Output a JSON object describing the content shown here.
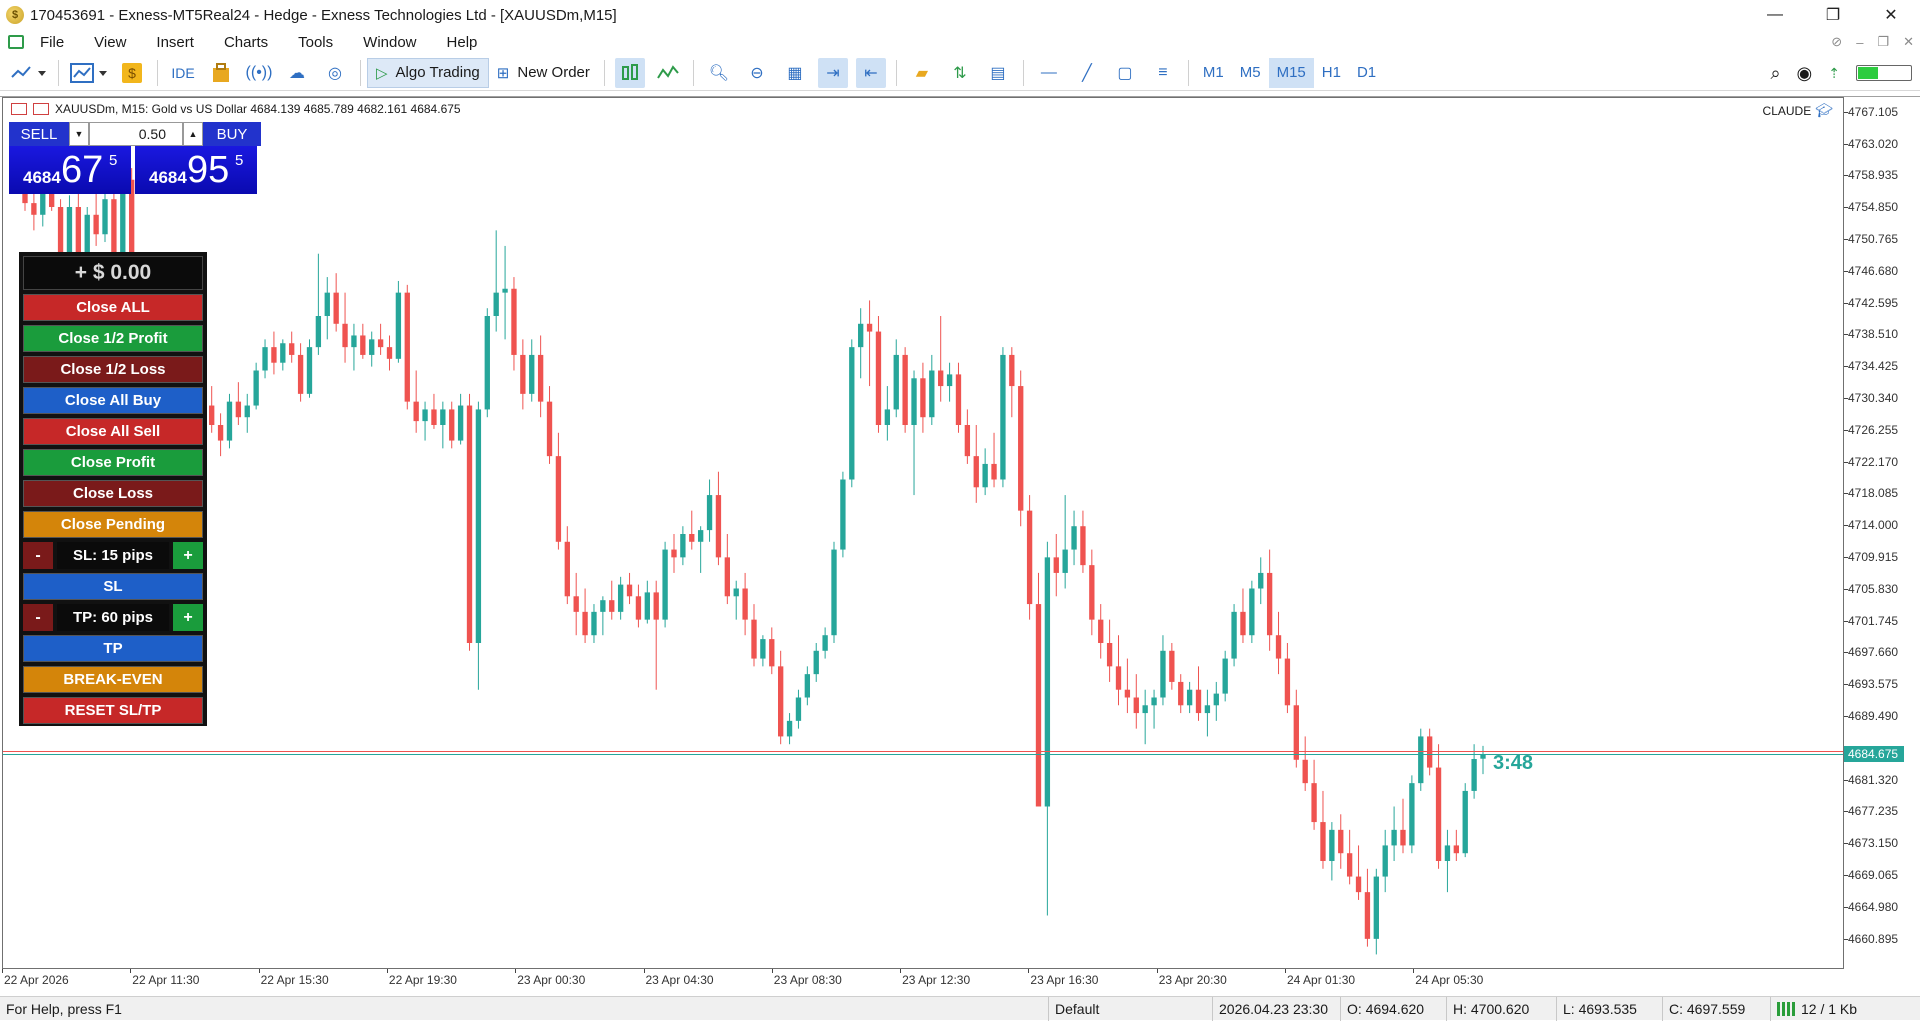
{
  "window": {
    "title": "170453691 - Exness-MT5Real24 - Hedge - Exness Technologies Ltd - [XAUUSDm,M15]",
    "controls": {
      "minimize": "—",
      "restore": "❐",
      "close": "✕"
    }
  },
  "menu": {
    "items": [
      "File",
      "View",
      "Insert",
      "Charts",
      "Tools",
      "Window",
      "Help"
    ]
  },
  "toolbar": {
    "ide_label": "IDE",
    "algo_label": "Algo Trading",
    "new_order_label": "New Order",
    "timeframes": [
      "M1",
      "M5",
      "M15",
      "H1",
      "D1"
    ],
    "active_timeframe": "M15"
  },
  "chart": {
    "info": "XAUUSDm, M15:  Gold vs US Dollar  4684.139 4685.789 4682.161 4684.675",
    "indicator_tag": "CLAUDE",
    "current_price_label": "4684.675",
    "countdown": "3:48",
    "up_color": "#26a69a",
    "down_color": "#ef5350",
    "price_labels": [
      "4767.105",
      "4763.020",
      "4758.935",
      "4754.850",
      "4750.765",
      "4746.680",
      "4742.595",
      "4738.510",
      "4734.425",
      "4730.340",
      "4726.255",
      "4722.170",
      "4718.085",
      "4714.000",
      "4709.915",
      "4705.830",
      "4701.745",
      "4697.660",
      "4693.575",
      "4689.490",
      "4681.320",
      "4677.235",
      "4673.150",
      "4669.065",
      "4664.980",
      "4660.895"
    ],
    "time_labels": [
      "22 Apr 2026",
      "22 Apr 11:30",
      "22 Apr 15:30",
      "22 Apr 19:30",
      "23 Apr 00:30",
      "23 Apr 04:30",
      "23 Apr 08:30",
      "23 Apr 12:30",
      "23 Apr 16:30",
      "23 Apr 20:30",
      "24 Apr 01:30",
      "24 Apr 05:30"
    ]
  },
  "one_click": {
    "sell_label": "SELL",
    "buy_label": "BUY",
    "lot": "0.50",
    "sell_small": "4684",
    "sell_big": "67",
    "sell_sup": "5",
    "buy_small": "4684",
    "buy_big": "95",
    "buy_sup": "5"
  },
  "panel": {
    "profit": "+ $ 0.00",
    "close_all": "Close ALL",
    "close_half_profit": "Close 1/2 Profit",
    "close_half_loss": "Close 1/2 Loss",
    "close_all_buy": "Close All Buy",
    "close_all_sell": "Close All Sell",
    "close_profit": "Close Profit",
    "close_loss": "Close Loss",
    "close_pending": "Close Pending",
    "minus": "-",
    "plus": "+",
    "sl_pips": "SL: 15 pips",
    "sl": "SL",
    "tp_pips": "TP: 60 pips",
    "tp": "TP",
    "break_even": "BREAK-EVEN",
    "reset": "RESET SL/TP"
  },
  "status": {
    "help": "For Help, press F1",
    "profile": "Default",
    "datetime": "2026.04.23 23:30",
    "open": "O: 4694.620",
    "high": "H: 4700.620",
    "low": "L: 4693.535",
    "close": "C: 4697.559",
    "traffic": "12 / 1 Kb"
  },
  "chart_data": {
    "type": "candlestick",
    "symbol": "XAUUSDm",
    "timeframe": "M15",
    "ylim": [
      4657.0,
      4769.0
    ],
    "candles": [
      [
        4757.0,
        4759.0,
        4754.5,
        4755.5
      ],
      [
        4755.5,
        4757.5,
        4752.0,
        4754.0
      ],
      [
        4754.0,
        4758.0,
        4752.5,
        4757.0
      ],
      [
        4757.0,
        4759.0,
        4754.5,
        4755.0
      ],
      [
        4755.0,
        4756.0,
        4747.0,
        4748.5
      ],
      [
        4748.5,
        4756.5,
        4748.0,
        4755.0
      ],
      [
        4755.0,
        4757.5,
        4746.0,
        4747.0
      ],
      [
        4747.0,
        4755.0,
        4746.5,
        4754.0
      ],
      [
        4754.0,
        4757.0,
        4750.0,
        4751.5
      ],
      [
        4751.5,
        4758.0,
        4750.5,
        4756.0
      ],
      [
        4756.0,
        4757.5,
        4748.0,
        4749.0
      ],
      [
        4749.0,
        4760.0,
        4748.5,
        4758.5
      ],
      [
        4758.5,
        4760.0,
        4745.0,
        4746.0
      ],
      [
        4746.0,
        4749.0,
        4742.0,
        4744.0
      ],
      [
        4744.0,
        4745.5,
        4734.0,
        4735.0
      ],
      [
        4735.0,
        4738.0,
        4733.0,
        4736.5
      ],
      [
        4736.5,
        4740.0,
        4735.5,
        4739.0
      ],
      [
        4739.0,
        4740.5,
        4733.5,
        4734.5
      ],
      [
        4734.5,
        4736.0,
        4728.0,
        4729.0
      ],
      [
        4729.0,
        4731.0,
        4725.5,
        4727.0
      ],
      [
        4727.0,
        4730.5,
        4726.0,
        4729.5
      ],
      [
        4729.5,
        4732.0,
        4726.0,
        4727.0
      ],
      [
        4727.0,
        4728.5,
        4723.0,
        4725.0
      ],
      [
        4725.0,
        4731.0,
        4724.0,
        4730.0
      ],
      [
        4730.0,
        4732.5,
        4727.0,
        4728.0
      ],
      [
        4728.0,
        4731.0,
        4726.0,
        4729.5
      ],
      [
        4729.5,
        4735.0,
        4729.0,
        4734.0
      ],
      [
        4734.0,
        4738.0,
        4733.0,
        4737.0
      ],
      [
        4737.0,
        4739.0,
        4733.5,
        4735.0
      ],
      [
        4735.0,
        4738.0,
        4734.0,
        4737.5
      ],
      [
        4737.5,
        4739.0,
        4735.0,
        4736.0
      ],
      [
        4736.0,
        4737.5,
        4730.0,
        4731.0
      ],
      [
        4731.0,
        4738.0,
        4730.5,
        4737.0
      ],
      [
        4737.0,
        4749.0,
        4736.0,
        4741.0
      ],
      [
        4741.0,
        4746.0,
        4738.0,
        4744.0
      ],
      [
        4744.0,
        4746.5,
        4739.0,
        4740.0
      ],
      [
        4740.0,
        4744.0,
        4735.0,
        4737.0
      ],
      [
        4737.0,
        4740.0,
        4734.0,
        4738.5
      ],
      [
        4738.5,
        4740.0,
        4735.5,
        4736.0
      ],
      [
        4736.0,
        4739.0,
        4734.5,
        4738.0
      ],
      [
        4738.0,
        4740.0,
        4736.0,
        4737.0
      ],
      [
        4737.0,
        4738.5,
        4734.0,
        4735.5
      ],
      [
        4735.5,
        4745.5,
        4735.0,
        4744.0
      ],
      [
        4744.0,
        4745.0,
        4729.0,
        4730.0
      ],
      [
        4730.0,
        4734.0,
        4726.0,
        4727.5
      ],
      [
        4727.5,
        4730.0,
        4725.0,
        4729.0
      ],
      [
        4729.0,
        4731.0,
        4726.5,
        4727.0
      ],
      [
        4727.0,
        4730.0,
        4724.0,
        4729.0
      ],
      [
        4729.0,
        4730.0,
        4724.0,
        4725.0
      ],
      [
        4725.0,
        4731.0,
        4724.5,
        4729.5
      ],
      [
        4729.5,
        4731.0,
        4698.0,
        4699.0
      ],
      [
        4699.0,
        4730.0,
        4693.0,
        4729.0
      ],
      [
        4729.0,
        4742.0,
        4728.0,
        4741.0
      ],
      [
        4741.0,
        4752.0,
        4739.0,
        4744.0
      ],
      [
        4744.0,
        4750.0,
        4738.0,
        4744.5
      ],
      [
        4744.5,
        4746.0,
        4734.0,
        4736.0
      ],
      [
        4736.0,
        4738.0,
        4729.0,
        4731.0
      ],
      [
        4731.0,
        4738.0,
        4730.0,
        4736.0
      ],
      [
        4736.0,
        4738.5,
        4728.0,
        4730.0
      ],
      [
        4730.0,
        4732.0,
        4722.0,
        4723.0
      ],
      [
        4723.0,
        4726.0,
        4711.0,
        4712.0
      ],
      [
        4712.0,
        4714.0,
        4704.0,
        4705.0
      ],
      [
        4705.0,
        4708.0,
        4700.0,
        4703.0
      ],
      [
        4703.0,
        4706.0,
        4699.0,
        4700.0
      ],
      [
        4700.0,
        4704.0,
        4699.0,
        4703.0
      ],
      [
        4703.0,
        4705.0,
        4700.0,
        4704.5
      ],
      [
        4704.5,
        4707.0,
        4702.0,
        4703.0
      ],
      [
        4703.0,
        4707.5,
        4702.0,
        4706.5
      ],
      [
        4706.5,
        4708.0,
        4704.0,
        4705.0
      ],
      [
        4705.0,
        4706.5,
        4701.0,
        4702.0
      ],
      [
        4702.0,
        4707.0,
        4701.5,
        4705.5
      ],
      [
        4705.5,
        4707.0,
        4693.0,
        4702.0
      ],
      [
        4702.0,
        4712.0,
        4701.0,
        4711.0
      ],
      [
        4711.0,
        4713.0,
        4708.0,
        4710.0
      ],
      [
        4710.0,
        4714.0,
        4709.0,
        4713.0
      ],
      [
        4713.0,
        4716.0,
        4711.0,
        4712.0
      ],
      [
        4712.0,
        4714.0,
        4708.0,
        4713.5
      ],
      [
        4713.5,
        4720.0,
        4712.0,
        4718.0
      ],
      [
        4718.0,
        4721.0,
        4709.0,
        4710.0
      ],
      [
        4710.0,
        4713.0,
        4704.0,
        4705.0
      ],
      [
        4705.0,
        4707.0,
        4702.0,
        4706.0
      ],
      [
        4706.0,
        4708.0,
        4700.0,
        4702.0
      ],
      [
        4702.0,
        4704.0,
        4696.0,
        4697.0
      ],
      [
        4697.0,
        4700.0,
        4696.0,
        4699.5
      ],
      [
        4699.5,
        4701.0,
        4695.0,
        4696.0
      ],
      [
        4696.0,
        4698.0,
        4686.0,
        4687.0
      ],
      [
        4687.0,
        4690.0,
        4686.0,
        4689.0
      ],
      [
        4689.0,
        4693.0,
        4688.0,
        4692.0
      ],
      [
        4692.0,
        4696.0,
        4691.0,
        4695.0
      ],
      [
        4695.0,
        4699.0,
        4694.0,
        4698.0
      ],
      [
        4698.0,
        4701.0,
        4697.0,
        4700.0
      ],
      [
        4700.0,
        4712.0,
        4699.0,
        4711.0
      ],
      [
        4711.0,
        4721.0,
        4710.0,
        4720.0
      ],
      [
        4720.0,
        4738.0,
        4719.0,
        4737.0
      ],
      [
        4737.0,
        4742.0,
        4733.0,
        4740.0
      ],
      [
        4740.0,
        4743.0,
        4732.0,
        4739.0
      ],
      [
        4739.0,
        4741.0,
        4726.0,
        4727.0
      ],
      [
        4727.0,
        4732.0,
        4725.0,
        4729.0
      ],
      [
        4729.0,
        4738.0,
        4728.0,
        4736.0
      ],
      [
        4736.0,
        4737.0,
        4726.0,
        4727.0
      ],
      [
        4727.0,
        4734.0,
        4718.0,
        4733.0
      ],
      [
        4733.0,
        4735.0,
        4726.0,
        4728.0
      ],
      [
        4728.0,
        4736.0,
        4727.0,
        4734.0
      ],
      [
        4734.0,
        4741.0,
        4730.0,
        4732.0
      ],
      [
        4732.0,
        4735.0,
        4730.0,
        4733.5
      ],
      [
        4733.5,
        4735.0,
        4726.0,
        4727.0
      ],
      [
        4727.0,
        4729.0,
        4722.0,
        4723.0
      ],
      [
        4723.0,
        4727.0,
        4717.0,
        4719.0
      ],
      [
        4719.0,
        4724.0,
        4718.0,
        4722.0
      ],
      [
        4722.0,
        4726.0,
        4719.0,
        4720.0
      ],
      [
        4720.0,
        4737.0,
        4719.0,
        4736.0
      ],
      [
        4736.0,
        4737.0,
        4728.0,
        4732.0
      ],
      [
        4732.0,
        4734.0,
        4714.0,
        4716.0
      ],
      [
        4716.0,
        4718.0,
        4702.0,
        4704.0
      ],
      [
        4704.0,
        4708.0,
        4690.0,
        4678.0
      ],
      [
        4678.0,
        4712.0,
        4664.0,
        4710.0
      ],
      [
        4710.0,
        4713.0,
        4705.0,
        4708.0
      ],
      [
        4708.0,
        4718.0,
        4706.0,
        4711.0
      ],
      [
        4711.0,
        4716.0,
        4709.0,
        4714.0
      ],
      [
        4714.0,
        4716.0,
        4708.0,
        4709.0
      ],
      [
        4709.0,
        4711.0,
        4700.0,
        4702.0
      ],
      [
        4702.0,
        4704.0,
        4697.0,
        4699.0
      ],
      [
        4699.0,
        4702.0,
        4694.0,
        4696.0
      ],
      [
        4696.0,
        4700.0,
        4691.0,
        4693.0
      ],
      [
        4693.0,
        4697.0,
        4690.0,
        4692.0
      ],
      [
        4692.0,
        4695.0,
        4688.0,
        4690.0
      ],
      [
        4690.0,
        4693.0,
        4686.0,
        4691.0
      ],
      [
        4691.0,
        4693.0,
        4688.0,
        4692.0
      ],
      [
        4692.0,
        4700.0,
        4691.0,
        4698.0
      ],
      [
        4698.0,
        4699.0,
        4693.0,
        4694.0
      ],
      [
        4694.0,
        4695.0,
        4690.0,
        4691.0
      ],
      [
        4691.0,
        4694.0,
        4690.0,
        4693.0
      ],
      [
        4693.0,
        4696.0,
        4689.0,
        4690.0
      ],
      [
        4690.0,
        4693.0,
        4687.0,
        4691.0
      ],
      [
        4691.0,
        4694.0,
        4689.0,
        4692.5
      ],
      [
        4692.5,
        4698.0,
        4691.5,
        4697.0
      ],
      [
        4697.0,
        4704.0,
        4696.0,
        4703.0
      ],
      [
        4703.0,
        4706.0,
        4699.0,
        4700.0
      ],
      [
        4700.0,
        4707.0,
        4699.0,
        4706.0
      ],
      [
        4706.0,
        4710.0,
        4704.0,
        4708.0
      ],
      [
        4708.0,
        4711.0,
        4698.0,
        4700.0
      ],
      [
        4700.0,
        4703.0,
        4695.0,
        4697.0
      ],
      [
        4697.0,
        4699.0,
        4690.0,
        4691.0
      ],
      [
        4691.0,
        4693.0,
        4683.0,
        4684.0
      ],
      [
        4684.0,
        4687.0,
        4680.0,
        4681.0
      ],
      [
        4681.0,
        4684.0,
        4675.0,
        4676.0
      ],
      [
        4676.0,
        4680.0,
        4670.0,
        4671.0
      ],
      [
        4671.0,
        4676.0,
        4668.5,
        4675.0
      ],
      [
        4675.0,
        4677.0,
        4670.0,
        4672.0
      ],
      [
        4672.0,
        4675.0,
        4668.0,
        4669.0
      ],
      [
        4669.0,
        4673.0,
        4666.0,
        4667.0
      ],
      [
        4667.0,
        4670.0,
        4660.0,
        4661.0
      ],
      [
        4661.0,
        4670.0,
        4659.0,
        4669.0
      ],
      [
        4669.0,
        4675.0,
        4667.0,
        4673.0
      ],
      [
        4673.0,
        4678.0,
        4671.0,
        4675.0
      ],
      [
        4675.0,
        4679.0,
        4672.0,
        4673.0
      ],
      [
        4673.0,
        4682.0,
        4672.0,
        4681.0
      ],
      [
        4681.0,
        4688.0,
        4680.0,
        4687.0
      ],
      [
        4687.0,
        4688.0,
        4682.0,
        4683.0
      ],
      [
        4683.0,
        4686.0,
        4670.0,
        4671.0
      ],
      [
        4671.0,
        4675.0,
        4667.0,
        4673.0
      ],
      [
        4673.0,
        4675.0,
        4671.0,
        4672.0
      ],
      [
        4672.0,
        4681.0,
        4671.5,
        4680.0
      ],
      [
        4680.0,
        4686.0,
        4679.0,
        4684.1
      ],
      [
        4684.139,
        4685.789,
        4682.161,
        4684.675
      ]
    ]
  }
}
